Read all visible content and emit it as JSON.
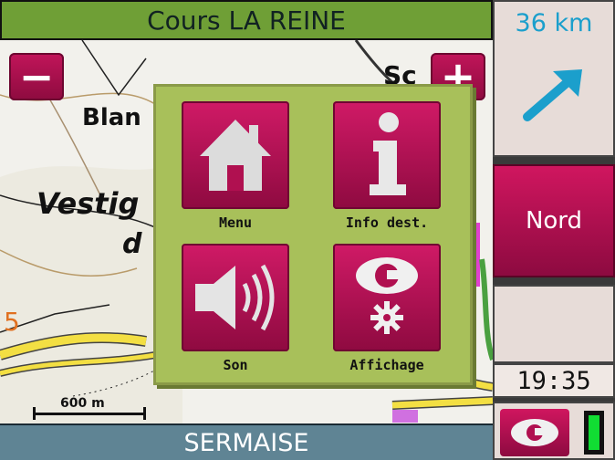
{
  "header": {
    "street": "Cours LA REINE"
  },
  "footer": {
    "city": "SERMAISE"
  },
  "zoom": {
    "out_label": "−",
    "in_label": "+"
  },
  "scale": {
    "label": "600 m"
  },
  "map": {
    "labels": [
      "Blan",
      "Vestig",
      "d",
      "5",
      "Sc"
    ]
  },
  "menu": {
    "items": [
      {
        "label": "Menu",
        "icon": "home-icon"
      },
      {
        "label": "Info dest.",
        "icon": "info-icon"
      },
      {
        "label": "Son",
        "icon": "speaker-icon"
      },
      {
        "label": "Affichage",
        "icon": "display-settings-icon"
      }
    ]
  },
  "panel": {
    "distance": "36 km",
    "direction_icon": "arrow-northeast-icon",
    "north_label": "Nord",
    "time": "19:35"
  },
  "colors": {
    "accent": "#c2155a",
    "street_bar": "#6f9f36",
    "city_bar": "#5f8494",
    "popup_bg": "#a8c05a",
    "distance_text": "#1b9fcc",
    "gps_ok": "#11dd33"
  }
}
